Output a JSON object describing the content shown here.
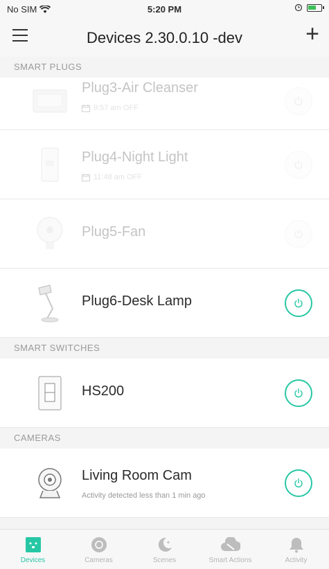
{
  "status_bar": {
    "carrier": "No SIM",
    "time": "5:20 PM"
  },
  "nav": {
    "title": "Devices 2.30.0.10 -dev"
  },
  "sections": {
    "smart_plugs": "SMART PLUGS",
    "smart_switches": "SMART SWITCHES",
    "cameras": "CAMERAS"
  },
  "devices": {
    "plug3": {
      "name": "Plug3-Air Cleanser",
      "schedule": "9:57 am OFF",
      "state": "offline"
    },
    "plug4": {
      "name": "Plug4-Night Light",
      "schedule": "11:48 am OFF",
      "state": "offline"
    },
    "plug5": {
      "name": "Plug5-Fan",
      "state": "offline"
    },
    "plug6": {
      "name": "Plug6-Desk Lamp",
      "state": "on"
    },
    "hs200": {
      "name": "HS200",
      "state": "on"
    },
    "cam": {
      "name": "Living Room Cam",
      "activity": "Activity detected less than 1 min ago",
      "state": "on"
    }
  },
  "tabs": [
    {
      "label": "Devices",
      "icon": "devices-icon",
      "active": true
    },
    {
      "label": "Cameras",
      "icon": "cameras-icon",
      "active": false
    },
    {
      "label": "Scenes",
      "icon": "scenes-icon",
      "active": false
    },
    {
      "label": "Smart Actions",
      "icon": "smart-actions-icon",
      "active": false
    },
    {
      "label": "Activity",
      "icon": "activity-icon",
      "active": false
    }
  ],
  "colors": {
    "accent": "#27c7a5",
    "inactive": "#b4b4b4",
    "section_bg": "#f4f4f4"
  }
}
